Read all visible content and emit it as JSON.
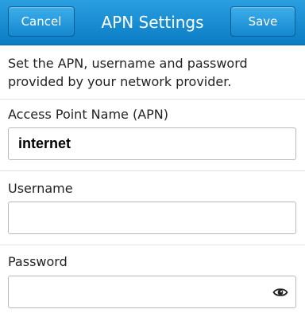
{
  "header": {
    "title": "APN Settings",
    "cancel_label": "Cancel",
    "save_label": "Save"
  },
  "description": "Set the APN, username and password provided by your network provider.",
  "fields": {
    "apn": {
      "label": "Access Point Name (APN)",
      "value": "internet"
    },
    "username": {
      "label": "Username",
      "value": ""
    },
    "password": {
      "label": "Password",
      "value": ""
    }
  },
  "icons": {
    "password_toggle": "eye-icon"
  },
  "colors": {
    "titlebar": "#1a8fd6",
    "button_border": "#0b5e93"
  }
}
